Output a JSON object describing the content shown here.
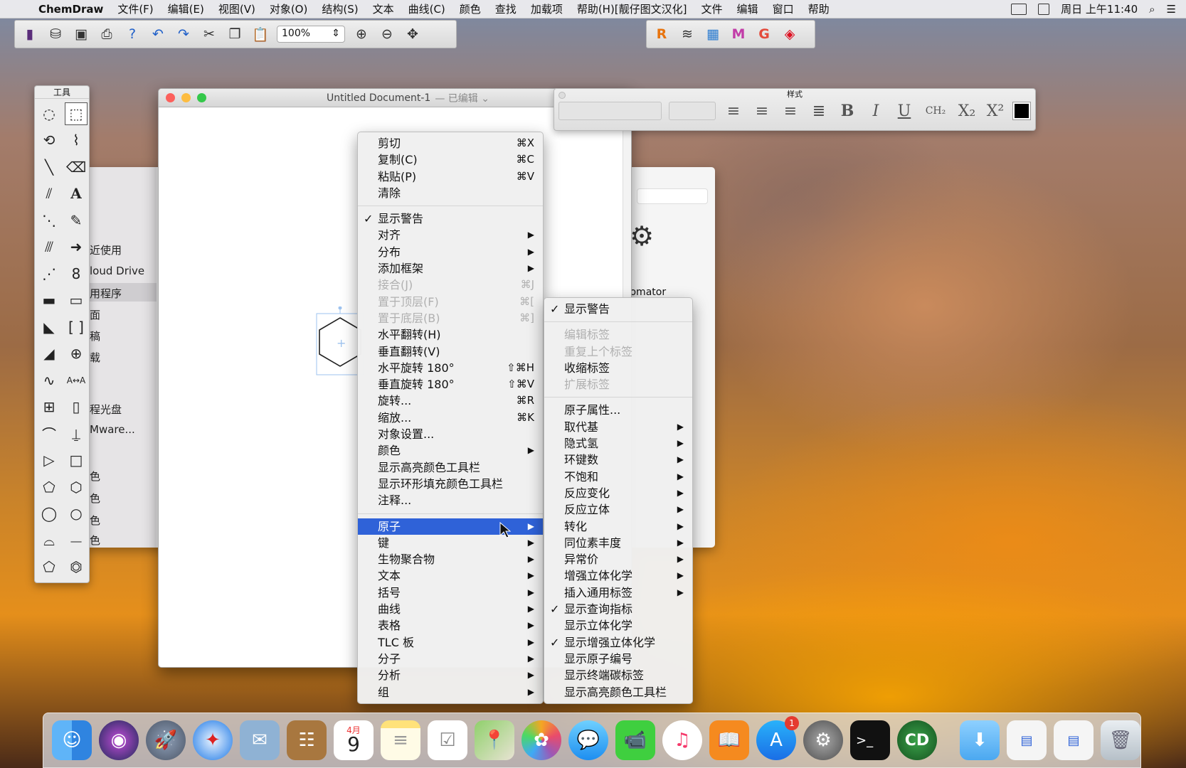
{
  "menubar": {
    "app": "ChemDraw",
    "items": [
      "文件(F)",
      "编辑(E)",
      "视图(V)",
      "对象(O)",
      "结构(S)",
      "文本",
      "曲线(C)",
      "颜色",
      "查找",
      "加载项",
      "帮助(H)[靓仔图文汉化]",
      "文件",
      "编辑",
      "窗口",
      "帮助"
    ],
    "clock": "周日 上午11:40"
  },
  "toolbar": {
    "zoom": "100%"
  },
  "tools": {
    "title": "工具"
  },
  "finder": {
    "items": [
      "近使用",
      "loud Drive",
      "用程序",
      "面",
      "稿",
      "载",
      "程光盘",
      "Mware...",
      "色",
      "色",
      "色",
      "色"
    ],
    "automator": "tomator"
  },
  "document": {
    "title": "Untitled Document-1",
    "edited": "— 已编辑 ⌄"
  },
  "style_panel": {
    "title": "样式"
  },
  "context_menu": [
    {
      "label": "剪切",
      "shortcut": "⌘X"
    },
    {
      "label": "复制(C)",
      "shortcut": "⌘C"
    },
    {
      "label": "粘贴(P)",
      "shortcut": "⌘V"
    },
    {
      "label": "清除"
    },
    {
      "sep": true
    },
    {
      "label": "显示警告",
      "check": "✓"
    },
    {
      "label": "对齐",
      "sub": true
    },
    {
      "label": "分布",
      "sub": true
    },
    {
      "label": "添加框架",
      "sub": true
    },
    {
      "label": "接合(J)",
      "shortcut": "⌘J",
      "disabled": true
    },
    {
      "label": "置于顶层(F)",
      "shortcut": "⌘[",
      "disabled": true
    },
    {
      "label": "置于底层(B)",
      "shortcut": "⌘]",
      "disabled": true
    },
    {
      "label": "水平翻转(H)"
    },
    {
      "label": "垂直翻转(V)"
    },
    {
      "label": "水平旋转 180°",
      "shortcut": "⇧⌘H"
    },
    {
      "label": "垂直旋转 180°",
      "shortcut": "⇧⌘V"
    },
    {
      "label": "旋转...",
      "shortcut": "⌘R"
    },
    {
      "label": "缩放...",
      "shortcut": "⌘K"
    },
    {
      "label": "对象设置..."
    },
    {
      "label": "颜色",
      "sub": true
    },
    {
      "label": "显示高亮颜色工具栏"
    },
    {
      "label": "显示环形填充颜色工具栏"
    },
    {
      "label": "注释..."
    },
    {
      "sep": true
    },
    {
      "label": "原子",
      "sub": true,
      "highlight": true
    },
    {
      "label": "键",
      "sub": true
    },
    {
      "label": "生物聚合物",
      "sub": true
    },
    {
      "label": "文本",
      "sub": true
    },
    {
      "label": "括号",
      "sub": true
    },
    {
      "label": "曲线",
      "sub": true
    },
    {
      "label": "表格",
      "sub": true
    },
    {
      "label": "TLC 板",
      "sub": true
    },
    {
      "label": "分子",
      "sub": true
    },
    {
      "label": "分析",
      "sub": true
    },
    {
      "label": "组",
      "sub": true
    }
  ],
  "atom_submenu": [
    {
      "label": "显示警告",
      "check": "✓"
    },
    {
      "sep": true
    },
    {
      "label": "编辑标签",
      "disabled": true
    },
    {
      "label": "重复上个标签",
      "disabled": true
    },
    {
      "label": "收缩标签"
    },
    {
      "label": "扩展标签",
      "disabled": true
    },
    {
      "sep": true
    },
    {
      "label": "原子属性..."
    },
    {
      "label": "取代基",
      "sub": true
    },
    {
      "label": "隐式氢",
      "sub": true
    },
    {
      "label": "环键数",
      "sub": true
    },
    {
      "label": "不饱和",
      "sub": true
    },
    {
      "label": "反应变化",
      "sub": true
    },
    {
      "label": "反应立体",
      "sub": true
    },
    {
      "label": "转化",
      "sub": true
    },
    {
      "label": "同位素丰度",
      "sub": true
    },
    {
      "label": "异常价",
      "sub": true
    },
    {
      "label": "增强立体化学",
      "sub": true
    },
    {
      "label": "插入通用标签",
      "sub": true
    },
    {
      "label": "显示查询指标",
      "check": "✓"
    },
    {
      "label": "显示立体化学"
    },
    {
      "label": "显示增强立体化学",
      "check": "✓"
    },
    {
      "label": "显示原子编号"
    },
    {
      "label": "显示终端碳标签"
    },
    {
      "label": "显示高亮颜色工具栏"
    }
  ],
  "dock": {
    "calendar_month": "4月",
    "calendar_day": "9",
    "appstore_badge": "1",
    "chemdraw_label": "CD"
  }
}
